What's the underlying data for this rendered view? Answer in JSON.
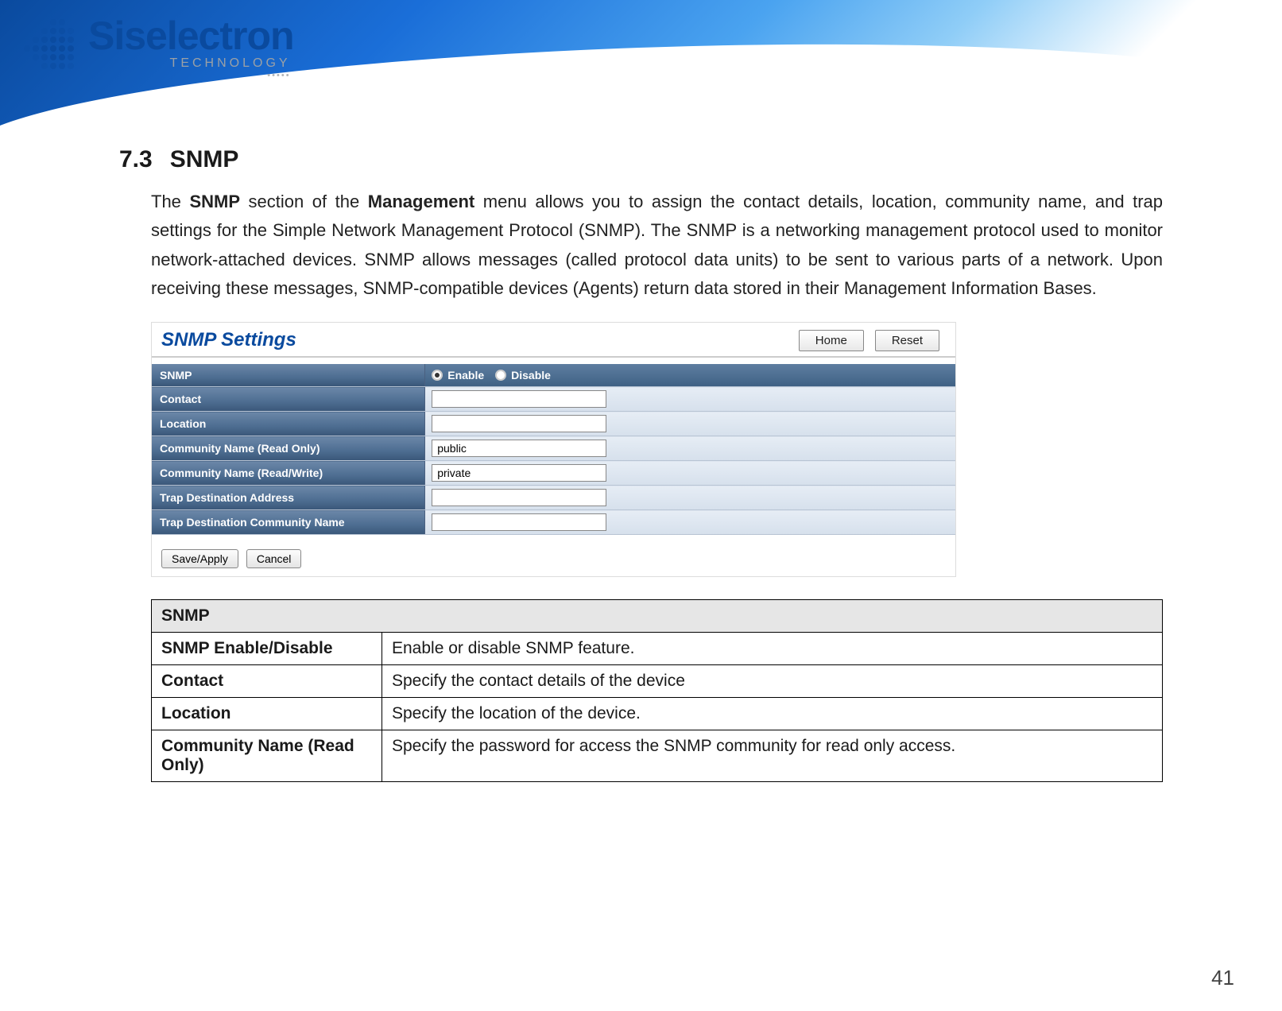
{
  "header": {
    "logo_main": "Siselectron",
    "logo_sub": "TECHNOLOGY",
    "logo_tag": "•••••"
  },
  "section": {
    "number": "7.3",
    "title": "SNMP"
  },
  "paragraph": {
    "pre": "The ",
    "bold1": "SNMP",
    "mid1": " section of the ",
    "bold2": "Management",
    "rest": " menu allows you to assign the contact details, location, community name, and trap settings for the Simple Network Management Protocol (SNMP). The SNMP is a networking management protocol used to monitor network-attached devices. SNMP allows messages (called protocol data units) to be sent to various parts of a network. Upon receiving these messages, SNMP-compatible devices (Agents) return data stored in their Management Information Bases."
  },
  "settings_panel": {
    "title": "SNMP Settings",
    "home_btn": "Home",
    "reset_btn": "Reset",
    "rows": {
      "snmp_label": "SNMP",
      "enable_label": "Enable",
      "disable_label": "Disable",
      "snmp_selected": "Enable",
      "contact_label": "Contact",
      "contact_value": "",
      "location_label": "Location",
      "location_value": "",
      "comm_ro_label": "Community Name (Read Only)",
      "comm_ro_value": "public",
      "comm_rw_label": "Community Name (Read/Write)",
      "comm_rw_value": "private",
      "trap_addr_label": "Trap Destination Address",
      "trap_addr_value": "",
      "trap_comm_label": "Trap Destination Community Name",
      "trap_comm_value": ""
    },
    "save_btn": "Save/Apply",
    "cancel_btn": "Cancel"
  },
  "desc_table": {
    "header": "SNMP",
    "rows": [
      {
        "term": "SNMP Enable/Disable",
        "desc": "Enable or disable SNMP feature."
      },
      {
        "term": "Contact",
        "desc": "Specify the contact details of the device"
      },
      {
        "term": "Location",
        "desc": "Specify the location of the device."
      },
      {
        "term": "Community Name (Read Only)",
        "desc": "Specify the password for access the SNMP community for read only access."
      }
    ]
  },
  "page_number": "41"
}
